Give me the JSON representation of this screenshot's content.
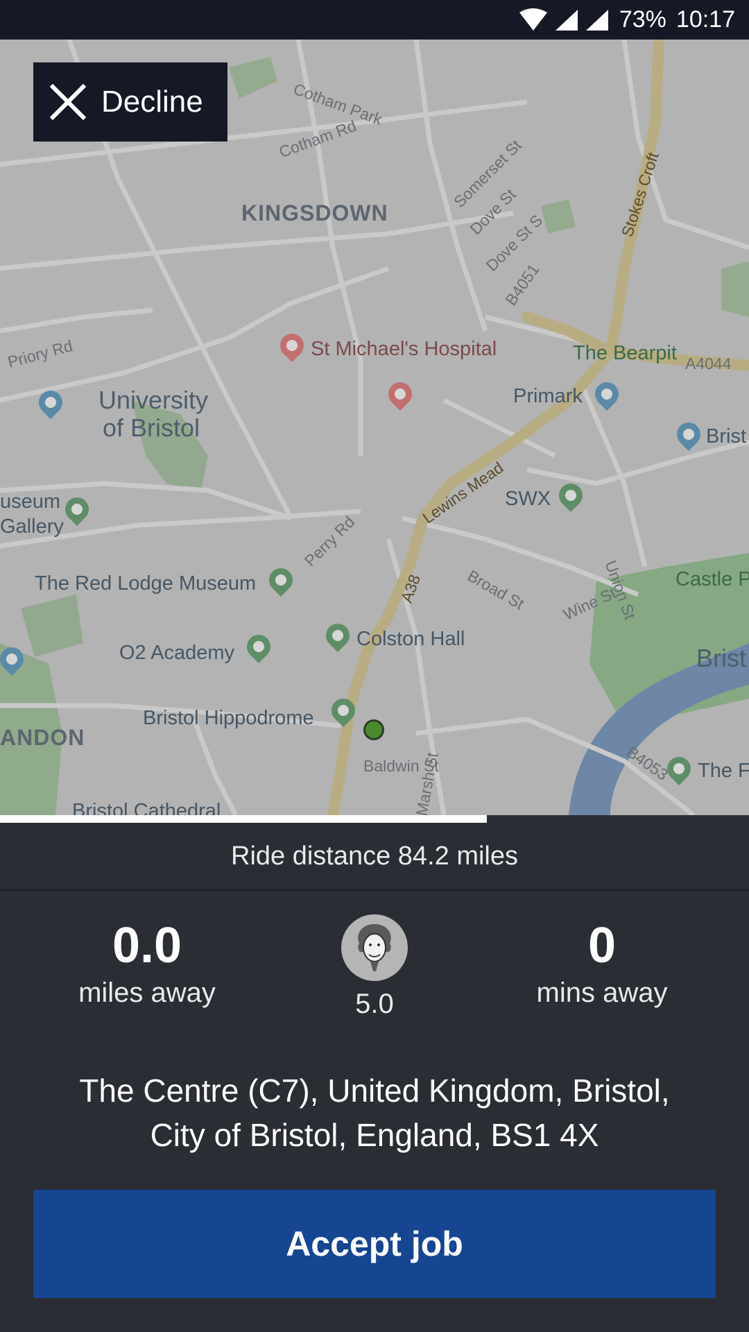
{
  "status_bar": {
    "battery": "73%",
    "time": "10:17",
    "icons": [
      "wifi-icon",
      "signal-icon",
      "signal-icon"
    ]
  },
  "decline_button": {
    "label": "Decline",
    "icon": "close-icon"
  },
  "map": {
    "labels": {
      "cotham_park": "Cotham Park",
      "cotham_rd": "Cotham Rd",
      "kingsdown": "KINGSDOWN",
      "somerset_st": "Somerset St",
      "dove_st": "Dove St",
      "dove_st_s": "Dove St S",
      "b4051": "B4051",
      "stokes_croft": "Stokes Croft",
      "priory_rd": "Priory Rd",
      "st_michaels": "St Michael's Hospital",
      "the_bearpit": "The Bearpit",
      "a4044": "A4044",
      "university_line1": "University",
      "university_line2": "of Bristol",
      "primark": "Primark",
      "brist_edge": "Brist",
      "lewins_mead": "Lewins Mead",
      "useum": "useum",
      "gallery": "Gallery",
      "swx": "SWX",
      "union_st": "Union St",
      "perry_rd": "Perry Rd",
      "red_lodge": "The Red Lodge Museum",
      "a38": "A38",
      "broad_st": "Broad St",
      "wine_st": "Wine St",
      "castle_edge": "Castle P",
      "o2_academy": "O2 Academy",
      "colston_hall": "Colston Hall",
      "bristol_edge": "Brist",
      "bristol_hippodrome": "Bristol Hippodrome",
      "baldwin_st": "Baldwin St",
      "andon": "ANDON",
      "b4053": "B4053",
      "the_f_edge": "The F",
      "marsh_st": "Marsh St",
      "bristol_cathedral": "Bristol Cathedral"
    }
  },
  "progress": {
    "fraction": 0.65
  },
  "ride_distance": "Ride distance 84.2 miles",
  "stats": {
    "distance_value": "0.0",
    "distance_caption": "miles away",
    "rating_value": "5.0",
    "eta_value": "0",
    "eta_caption": "mins away"
  },
  "address": {
    "line1": "The Centre (C7), United Kingdom, Bristol,",
    "line2": "City of Bristol, England, BS1 4X"
  },
  "accept_button": {
    "label": "Accept job"
  }
}
